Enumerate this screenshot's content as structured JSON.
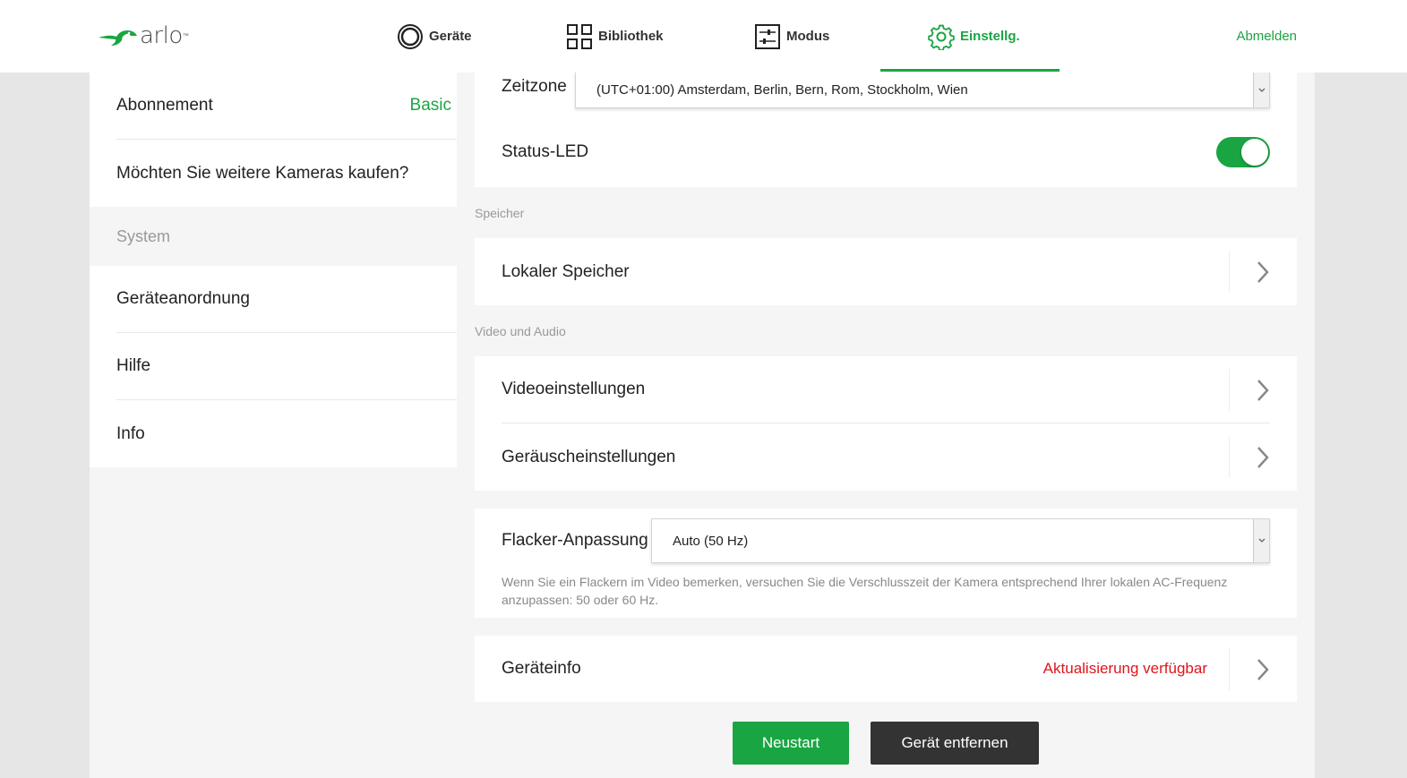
{
  "header": {
    "logo_text": "arlo",
    "logo_tm": "™",
    "nav": [
      {
        "label": "Geräte",
        "icon": "camera-icon"
      },
      {
        "label": "Bibliothek",
        "icon": "grid-icon"
      },
      {
        "label": "Modus",
        "icon": "sliders-icon"
      },
      {
        "label": "Einstellg.",
        "icon": "gear-icon",
        "active": true
      }
    ],
    "logout_label": "Abmelden"
  },
  "sidebar": {
    "items_top": [
      {
        "label": "Abonnement",
        "value": "Basic"
      },
      {
        "label": "Möchten Sie weitere Kameras kaufen?"
      }
    ],
    "section_label": "System",
    "items_system": [
      {
        "label": "Geräteanordnung"
      },
      {
        "label": "Hilfe"
      },
      {
        "label": "Info"
      }
    ]
  },
  "main": {
    "timezone": {
      "label": "Zeitzone",
      "value": "(UTC+01:00) Amsterdam, Berlin, Bern, Rom, Stockholm, Wien"
    },
    "status_led": {
      "label": "Status-LED",
      "on": true
    },
    "storage": {
      "section_label": "Speicher",
      "local_storage_label": "Lokaler Speicher"
    },
    "video_audio": {
      "section_label": "Video und Audio",
      "video_settings_label": "Videoeinstellungen",
      "sound_settings_label": "Geräuscheinstellungen"
    },
    "flicker": {
      "label": "Flacker-Anpassung",
      "value": "Auto (50 Hz)",
      "hint": "Wenn Sie ein Flackern im Video bemerken, versuchen Sie die Verschlusszeit der Kamera entsprechend Ihrer lokalen AC-Frequenz anzupassen: 50 oder 60 Hz."
    },
    "device_info": {
      "label": "Geräteinfo",
      "status": "Aktualisierung verfügbar"
    },
    "buttons": {
      "restart_label": "Neustart",
      "remove_label": "Gerät entfernen"
    }
  },
  "colors": {
    "accent": "#1aa543",
    "alert": "#e0141e",
    "dark_button": "#333333"
  }
}
